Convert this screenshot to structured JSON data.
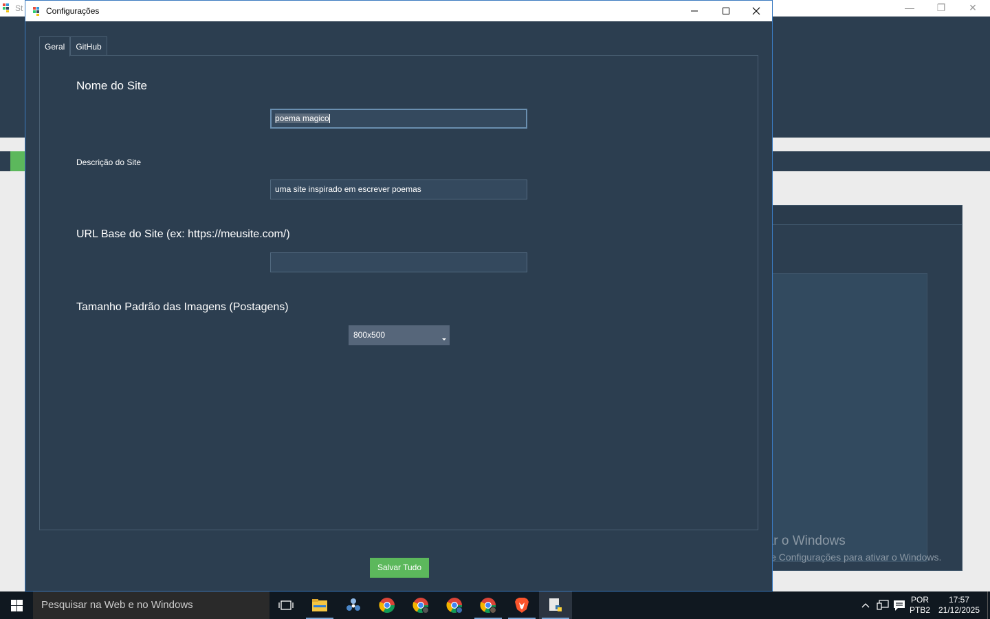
{
  "background_app": {
    "title_fragment": "St",
    "watermark_line1": "Ativar o Windows",
    "watermark_line2": "Acesse Configurações para ativar o Windows."
  },
  "dialog": {
    "title": "Configurações",
    "icon": "app-icon",
    "controls": [
      "minimize-icon",
      "maximize-icon",
      "close-icon"
    ]
  },
  "tabs": [
    {
      "label": "Geral",
      "active": true
    },
    {
      "label": "GitHub",
      "active": false
    }
  ],
  "form": {
    "site_name_label": "Nome do Site",
    "site_name_value": "poema magico",
    "site_description_label": "Descrição do Site",
    "site_description_value": "uma site inspirado em escrever poemas",
    "base_url_label": "URL Base do Site (ex: https://meusite.com/)",
    "base_url_value": "",
    "image_size_label": "Tamanho Padrão das Imagens (Postagens)",
    "image_size_value": "800x500"
  },
  "save_button_label": "Salvar Tudo",
  "taskbar": {
    "search_placeholder": "Pesquisar na Web e no Windows",
    "apps": [
      "task-view-icon",
      "file-explorer-icon",
      "gaming-app-icon",
      "chrome-icon",
      "chrome-profile-icon",
      "chrome-profile-icon",
      "chrome-profile-icon",
      "brave-icon",
      "python-app-icon"
    ],
    "language_top": "POR",
    "language_bottom": "PTB2",
    "time": "17:57",
    "date": "21/12/2025"
  },
  "colors": {
    "dialog_bg": "#2c3e50",
    "accent_green": "#5cb85c",
    "input_bg": "#34495e"
  }
}
